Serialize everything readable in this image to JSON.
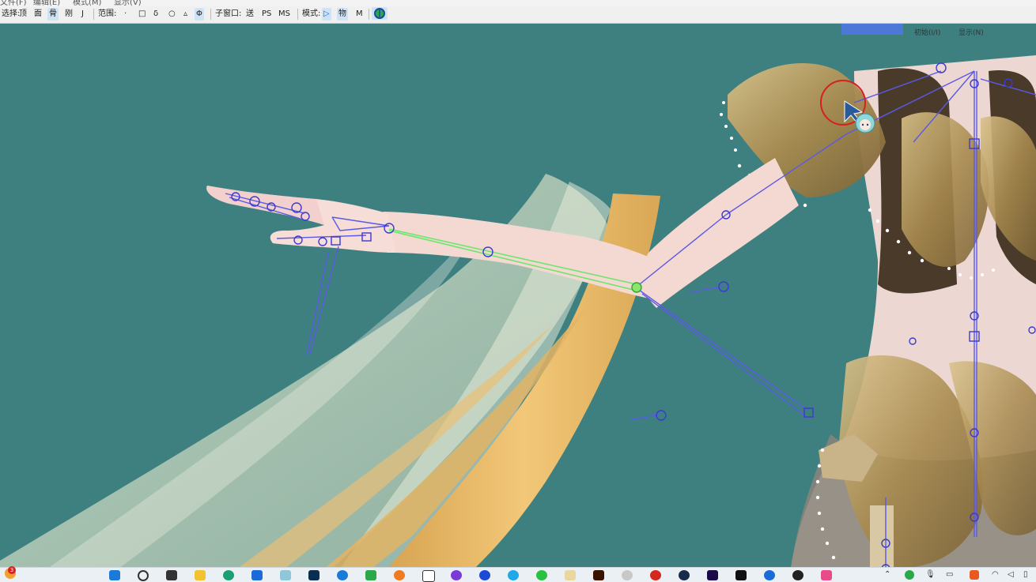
{
  "menubar": {
    "items": [
      "文件(F)",
      "编辑(E)",
      "模式(M)",
      "显示(V)"
    ]
  },
  "toolbar": {
    "select_label": "选择:",
    "select_buttons": [
      "顶",
      "面",
      "骨",
      "刚",
      "J"
    ],
    "range_label": "范围:",
    "range_buttons": [
      "·",
      "□",
      "δ",
      "○",
      "▵",
      "Φ"
    ],
    "subwindow_label": "子窗口:",
    "subwindow_buttons": [
      "送",
      "PS",
      "MS"
    ],
    "mode_label": "模式:",
    "mode_buttons": [
      "▷",
      "物",
      "M"
    ]
  },
  "viewport": {
    "init_label": "初始(I/I)",
    "display_label": "显示(N)"
  },
  "taskbar": {
    "notification_badge": "3",
    "icons": [
      "start-icon",
      "search-icon",
      "taskview-icon",
      "file-explorer-icon",
      "edge-icon",
      "mail-icon",
      "character-app-icon",
      "photoshop-icon",
      "blue-app-icon",
      "green-app-icon",
      "blender-icon",
      "box-app-icon",
      "purple-app-icon",
      "blue-ball-icon",
      "cyan-app-icon",
      "wechat-icon",
      "paint-icon",
      "illustrator-icon",
      "gear-app-icon",
      "netease-music-icon",
      "steam-icon",
      "premiere-icon",
      "capcut-icon",
      "browser-icon",
      "qq-icon",
      "game-icon"
    ],
    "colors": {
      "photoshop": "#0b2d4f",
      "illustrator": "#3a1200",
      "premiere": "#1b0a4a",
      "netease": "#d6271e"
    }
  },
  "colors": {
    "viewport_bg": "#3e8080",
    "bone": "#5a5ae6",
    "bone_selected": "#6ee66e",
    "skin": "#f4d6d0",
    "ribbon": "#e8b860",
    "veil": "#d8e0c8",
    "gold_armor": "#b89a5e"
  }
}
